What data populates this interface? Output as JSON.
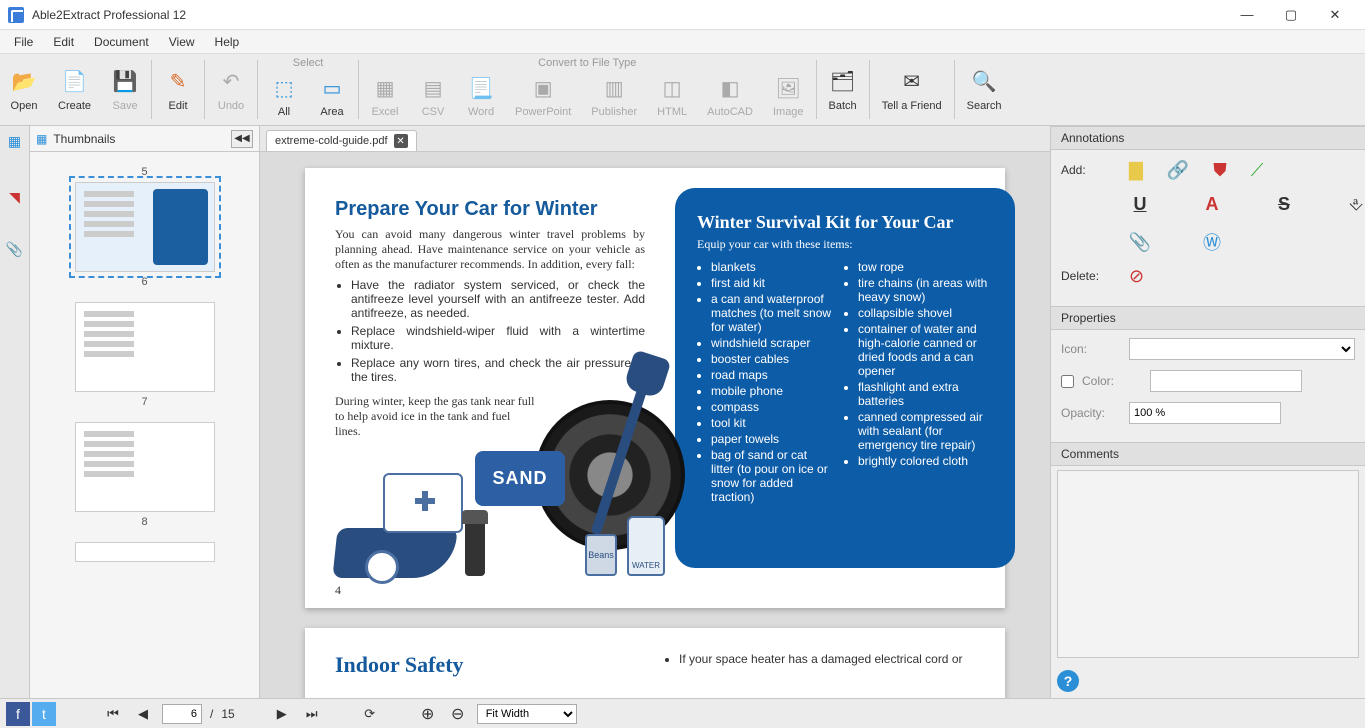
{
  "app": {
    "title": "Able2Extract Professional 12"
  },
  "menu": {
    "file": "File",
    "edit": "Edit",
    "document": "Document",
    "view": "View",
    "help": "Help"
  },
  "toolbar": {
    "open": "Open",
    "create": "Create",
    "save": "Save",
    "edit": "Edit",
    "undo": "Undo",
    "group_select": "Select",
    "all": "All",
    "area": "Area",
    "group_convert": "Convert to File Type",
    "excel": "Excel",
    "csv": "CSV",
    "word": "Word",
    "powerpoint": "PowerPoint",
    "publisher": "Publisher",
    "html": "HTML",
    "autocad": "AutoCAD",
    "image": "Image",
    "batch": "Batch",
    "tell": "Tell a Friend",
    "search": "Search"
  },
  "thumbs": {
    "title": "Thumbnails",
    "p5": "5",
    "p6": "6",
    "p7": "7",
    "p8": "8"
  },
  "tab": {
    "name": "extreme-cold-guide.pdf"
  },
  "doc": {
    "h_prepare": "Prepare Your Car for Winter",
    "intro": "You can avoid many dangerous winter travel problems by planning ahead. Have maintenance service on your vehicle as often as the manufacturer recommends. In addition, every fall:",
    "prep": [
      "Have the radiator system serviced, or check the antifreeze level yourself with an antifreeze tester. Add antifreeze, as needed.",
      "Replace windshield-wiper fluid with a wintertime mixture.",
      "Replace any worn tires, and check the air pressure in the tires."
    ],
    "tank": "During winter, keep the gas tank near full to help avoid ice in the tank and fuel lines.",
    "kit_title": "Winter Survival Kit for Your Car",
    "kit_sub": "Equip your car with these items:",
    "kit_col1": [
      "blankets",
      "first aid kit",
      "a can and waterproof matches (to melt snow for water)",
      "windshield scraper",
      "booster cables",
      "road maps",
      "mobile phone",
      "compass",
      "tool kit",
      "paper towels",
      "bag of sand or cat litter (to pour on ice or snow for added traction)"
    ],
    "kit_col2": [
      "tow rope",
      "tire chains (in areas with heavy snow)",
      "collapsible shovel",
      "container of water and high-calorie canned or dried foods and a can opener",
      "flashlight and extra batteries",
      "canned compressed air with sealant (for emergency tire repair)",
      "brightly colored cloth"
    ],
    "pg4": "4",
    "sand": "SAND",
    "beans": "Beans",
    "water": "WATER",
    "h_indoor": "Indoor Safety",
    "frag": "If your space heater has a damaged electrical cord or"
  },
  "right": {
    "annot_header": "Annotations",
    "add": "Add:",
    "delete": "Delete:",
    "props_header": "Properties",
    "icon": "Icon:",
    "color": "Color:",
    "opacity_lbl": "Opacity:",
    "opacity_val": "100 %",
    "comments_header": "Comments"
  },
  "status": {
    "page_current": "6",
    "page_sep": "/",
    "page_total": "15",
    "zoom_mode": "Fit Width"
  }
}
